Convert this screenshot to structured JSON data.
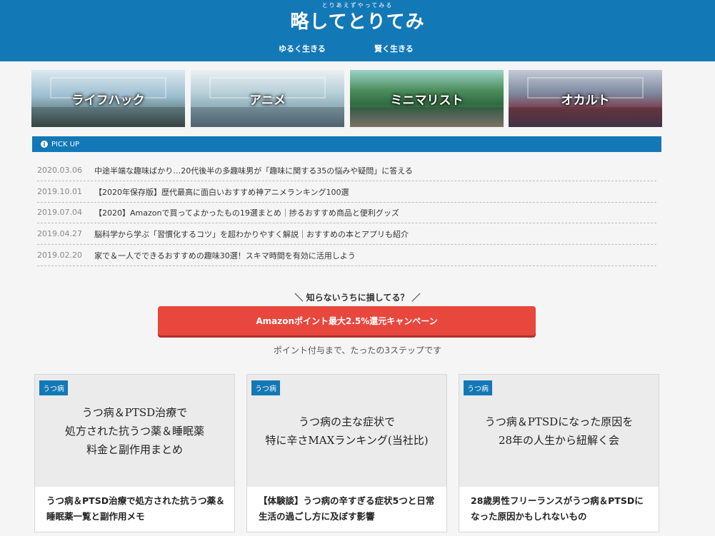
{
  "header": {
    "title_ruby": "とりあえずやってみる",
    "title": "略してとりてみ",
    "nav": [
      "ゆるく生きる",
      "賢く生きる"
    ]
  },
  "categories": [
    "ライフハック",
    "アニメ",
    "ミニマリスト",
    "オカルト"
  ],
  "pickup": {
    "label": "PICK UP",
    "items": [
      {
        "date": "2020.03.06",
        "title": "中途半端な趣味ばかり…20代後半の多趣味男が「趣味に関する35の悩みや疑問」に答える"
      },
      {
        "date": "2019.10.01",
        "title": "【2020年保存版】歴代最高に面白いおすすめ神アニメランキング100選"
      },
      {
        "date": "2019.07.04",
        "title": "【2020】Amazonで買ってよかったもの19選まとめ｜捗るおすすめ商品と便利グッズ"
      },
      {
        "date": "2019.04.27",
        "title": "脳科学から学ぶ「習慣化するコツ」を超わかりやすく解説｜おすすめの本とアプリも紹介"
      },
      {
        "date": "2019.02.20",
        "title": "家で＆一人でできるおすすめの趣味30選！スキマ時間を有効に活用しよう"
      }
    ]
  },
  "campaign": {
    "lead": "＼ 知らないうちに損してる？ ／",
    "button": "Amazonポイント最大2.5%還元キャンペーン",
    "note": "ポイント付与まで、たったの3ステップです"
  },
  "cards": [
    {
      "badge": "うつ病",
      "thumb_text": "うつ病＆PTSD治療で\n処方された抗うつ薬＆睡眠薬\n料金と副作用まとめ",
      "title": "うつ病＆PTSD治療で処方された抗うつ薬＆睡眠薬一覧と副作用メモ"
    },
    {
      "badge": "うつ病",
      "thumb_text": "うつ病の主な症状で\n特に辛さMAXランキング(当社比)",
      "title": "【体験談】うつ病の辛すぎる症状5つと日常生活の過ごし方に及ぼす影響"
    },
    {
      "badge": "うつ病",
      "thumb_text": "うつ病＆PTSDになった原因を\n28年の人生から紐解く会",
      "title": "28歳男性フリーランスがうつ病＆PTSDになった原因かもしれないもの"
    }
  ],
  "colors": {
    "brand": "#1378b6",
    "cta": "#e8473e"
  }
}
